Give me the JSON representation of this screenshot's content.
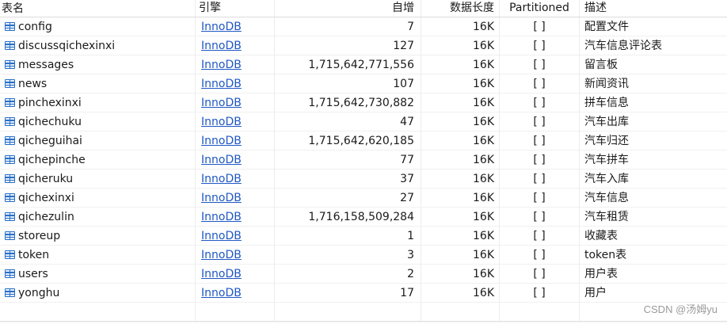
{
  "columns": {
    "name": "表名",
    "engine": "引擎",
    "auto_increment": "自增",
    "data_length": "数据长度",
    "partitioned": "Partitioned",
    "comment": "描述"
  },
  "rows": [
    {
      "name": "config",
      "engine": "InnoDB",
      "auto_increment": "7",
      "data_length": "16K",
      "partitioned": "[ ]",
      "comment": "配置文件"
    },
    {
      "name": "discussqichexinxi",
      "engine": "InnoDB",
      "auto_increment": "127",
      "data_length": "16K",
      "partitioned": "[ ]",
      "comment": "汽车信息评论表"
    },
    {
      "name": "messages",
      "engine": "InnoDB",
      "auto_increment": "1,715,642,771,556",
      "data_length": "16K",
      "partitioned": "[ ]",
      "comment": "留言板"
    },
    {
      "name": "news",
      "engine": "InnoDB",
      "auto_increment": "107",
      "data_length": "16K",
      "partitioned": "[ ]",
      "comment": "新闻资讯"
    },
    {
      "name": "pinchexinxi",
      "engine": "InnoDB",
      "auto_increment": "1,715,642,730,882",
      "data_length": "16K",
      "partitioned": "[ ]",
      "comment": "拼车信息"
    },
    {
      "name": "qichechuku",
      "engine": "InnoDB",
      "auto_increment": "47",
      "data_length": "16K",
      "partitioned": "[ ]",
      "comment": "汽车出库"
    },
    {
      "name": "qicheguihai",
      "engine": "InnoDB",
      "auto_increment": "1,715,642,620,185",
      "data_length": "16K",
      "partitioned": "[ ]",
      "comment": "汽车归还"
    },
    {
      "name": "qichepinche",
      "engine": "InnoDB",
      "auto_increment": "77",
      "data_length": "16K",
      "partitioned": "[ ]",
      "comment": "汽车拼车"
    },
    {
      "name": "qicheruku",
      "engine": "InnoDB",
      "auto_increment": "37",
      "data_length": "16K",
      "partitioned": "[ ]",
      "comment": "汽车入库"
    },
    {
      "name": "qichexinxi",
      "engine": "InnoDB",
      "auto_increment": "27",
      "data_length": "16K",
      "partitioned": "[ ]",
      "comment": "汽车信息"
    },
    {
      "name": "qichezulin",
      "engine": "InnoDB",
      "auto_increment": "1,716,158,509,284",
      "data_length": "16K",
      "partitioned": "[ ]",
      "comment": "汽车租赁"
    },
    {
      "name": "storeup",
      "engine": "InnoDB",
      "auto_increment": "1",
      "data_length": "16K",
      "partitioned": "[ ]",
      "comment": "收藏表"
    },
    {
      "name": "token",
      "engine": "InnoDB",
      "auto_increment": "3",
      "data_length": "16K",
      "partitioned": "[ ]",
      "comment": "token表"
    },
    {
      "name": "users",
      "engine": "InnoDB",
      "auto_increment": "2",
      "data_length": "16K",
      "partitioned": "[ ]",
      "comment": "用户表"
    },
    {
      "name": "yonghu",
      "engine": "InnoDB",
      "auto_increment": "17",
      "data_length": "16K",
      "partitioned": "[ ]",
      "comment": "用户"
    }
  ],
  "icons": {
    "table": "table-icon"
  },
  "watermark": "CSDN @汤姆yu",
  "colors": {
    "link": "#1f57c3",
    "icon": "#2a6fc7"
  }
}
